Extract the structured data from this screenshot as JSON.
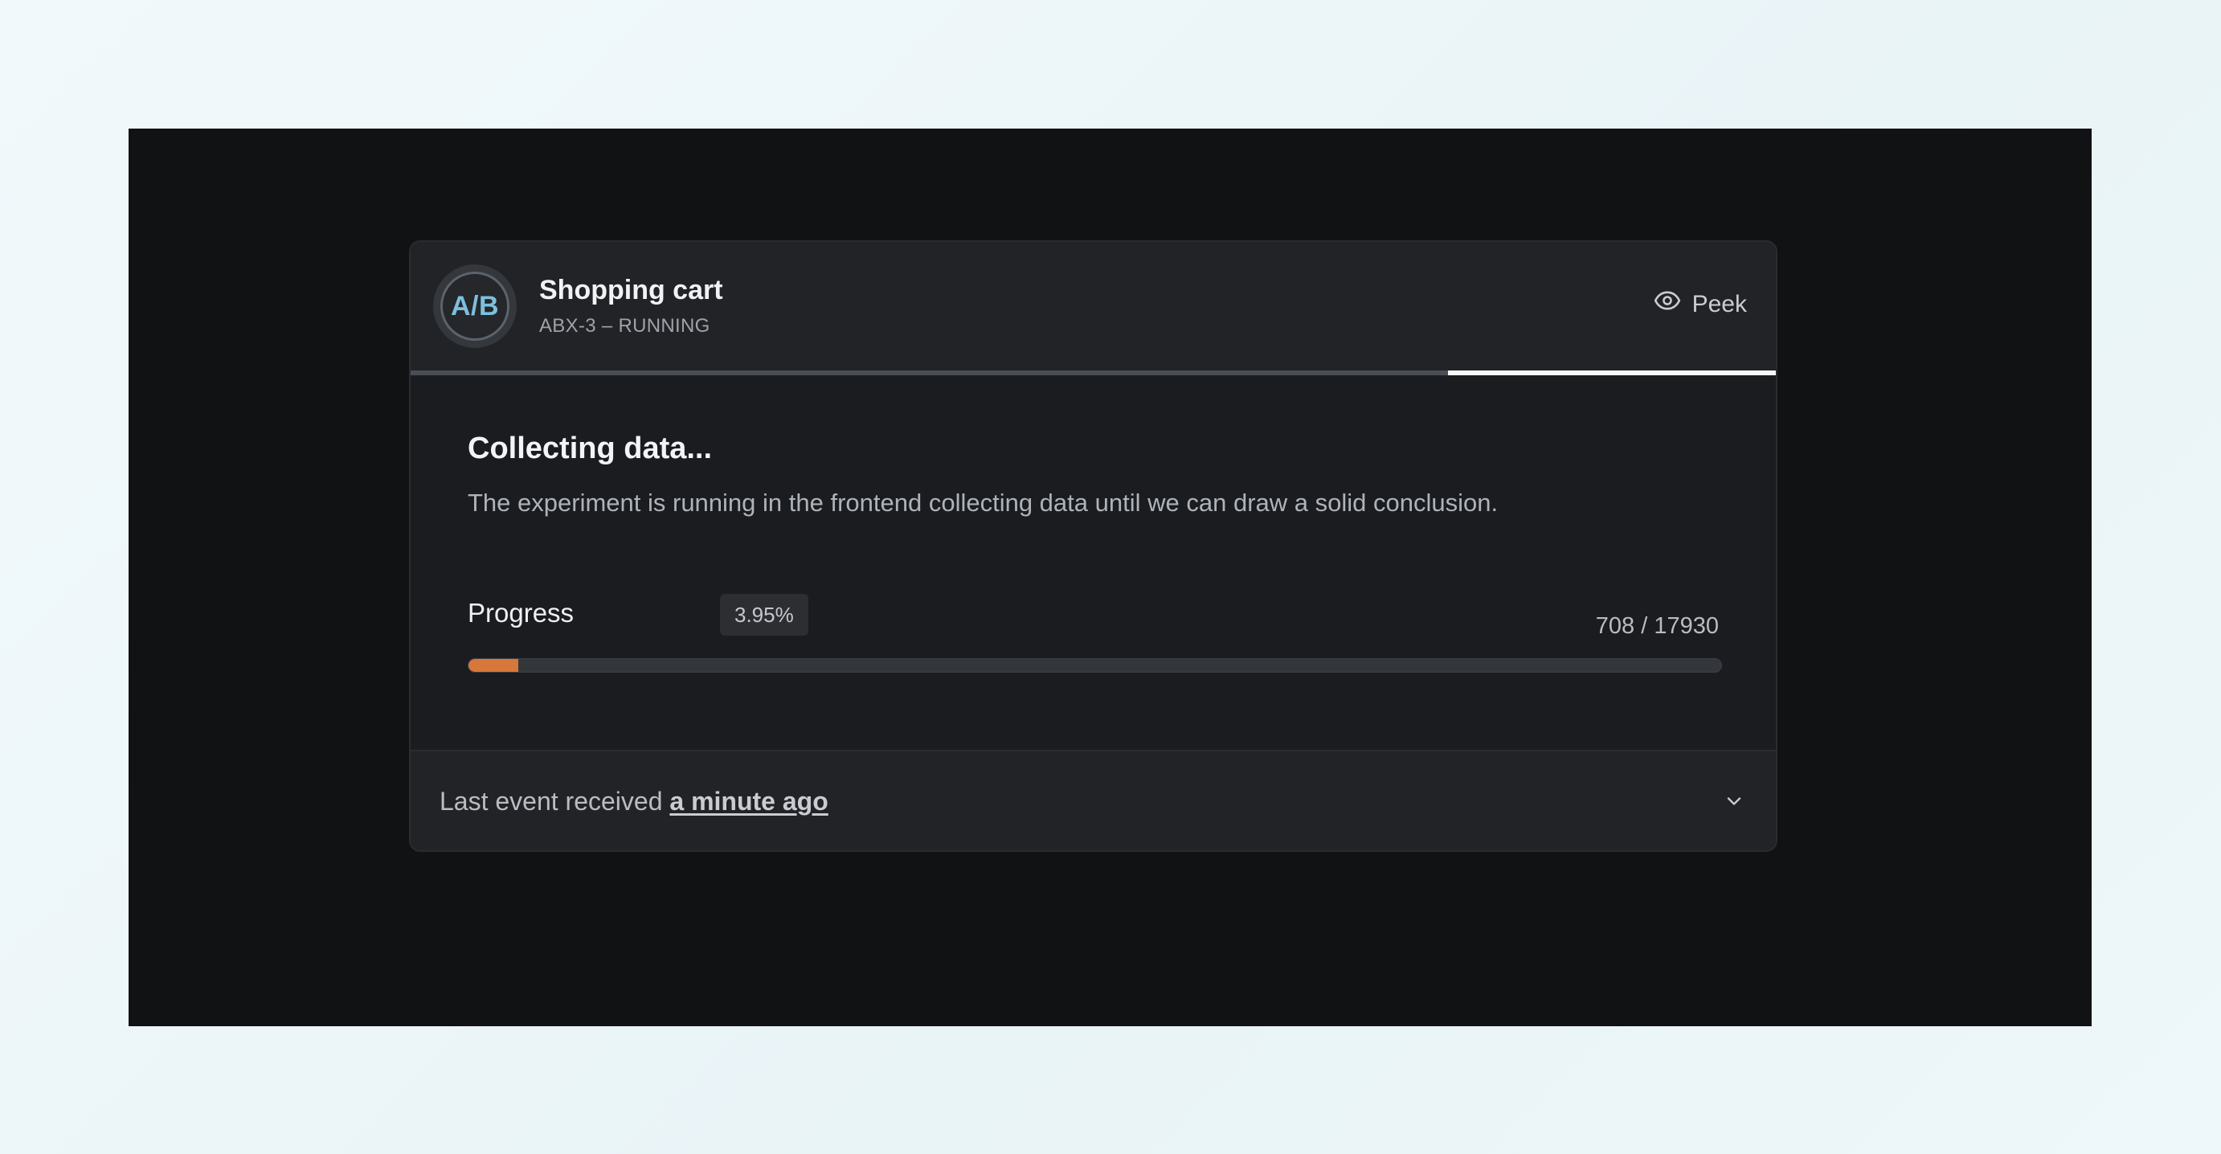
{
  "experiment": {
    "avatar_text": "A/B",
    "title": "Shopping cart",
    "subtitle": "ABX-3 – RUNNING",
    "peek_label": "Peek",
    "timeline_elapsed_fraction": 0.24
  },
  "status": {
    "heading": "Collecting data...",
    "description": "The experiment is running in the frontend collecting data until we can draw a solid conclusion."
  },
  "progress": {
    "label": "Progress",
    "percent_text": "3.95%",
    "count_text": "708 / 17930",
    "current": 708,
    "total": 17930,
    "fill_color": "#d8773a"
  },
  "footer": {
    "prefix": "Last event received ",
    "time_link": "a minute ago"
  },
  "icons": {
    "peek": "eye-icon",
    "expand": "chevron-down-icon"
  }
}
